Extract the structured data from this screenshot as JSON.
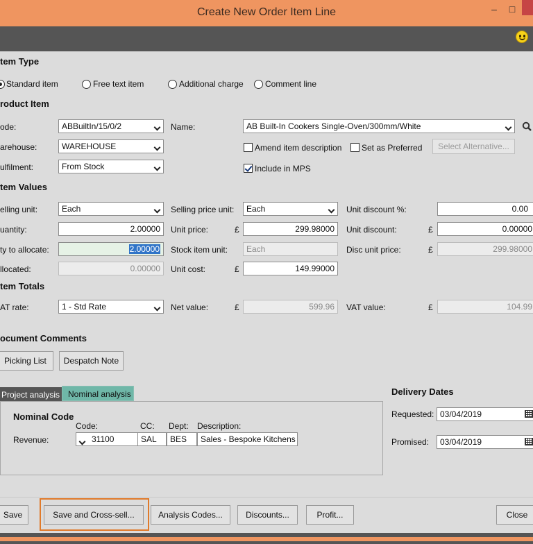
{
  "window": {
    "title": "Create New Order Item Line",
    "minimize_glyph": "–",
    "maximize_glyph": "□",
    "status_icon": "smiley-icon"
  },
  "item_type": {
    "heading": "tem Type",
    "options": [
      "Standard item",
      "Free text item",
      "Additional charge",
      "Comment line"
    ],
    "selected": "Standard item"
  },
  "product_item": {
    "heading": "roduct Item",
    "code_label": "ode:",
    "code_value": "ABBuiltIn/15/0/2",
    "name_label": "Name:",
    "name_value": "AB Built-In Cookers Single-Oven/300mm/White",
    "warehouse_label": "arehouse:",
    "warehouse_value": "WAREHOUSE",
    "fulfilment_label": "ulfilment:",
    "fulfilment_value": "From Stock",
    "amend_label": "Amend item description",
    "preferred_label": "Set as Preferred",
    "alternative_button": "Select Alternative...",
    "include_mps_label": "Include in MPS",
    "amend_checked": false,
    "preferred_checked": false,
    "include_mps_checked": true
  },
  "item_values": {
    "heading": "tem Values",
    "selling_unit_label": "elling unit:",
    "selling_unit_value": "Each",
    "selling_price_unit_label": "Selling price unit:",
    "selling_price_unit_value": "Each",
    "unit_discount_pct_label": "Unit discount %:",
    "unit_discount_pct_value": "0.00",
    "quantity_label": "uantity:",
    "quantity_value": "2.00000",
    "unit_price_label": "Unit price:",
    "unit_price_currency": "£",
    "unit_price_value": "299.98000",
    "unit_discount_label": "Unit discount:",
    "unit_discount_currency": "£",
    "unit_discount_value": "0.00000",
    "qty_allocate_label": "ty to allocate:",
    "qty_allocate_value": "2.00000",
    "stock_item_unit_label": "Stock item unit:",
    "stock_item_unit_value": "Each",
    "disc_unit_price_label": "Disc unit price:",
    "disc_unit_price_currency": "£",
    "disc_unit_price_value": "299.98000",
    "allocated_label": "llocated:",
    "allocated_value": "0.00000",
    "unit_cost_label": "Unit cost:",
    "unit_cost_currency": "£",
    "unit_cost_value": "149.99000"
  },
  "item_totals": {
    "heading": "tem Totals",
    "vat_rate_label": "AT rate:",
    "vat_rate_value": "1 - Std Rate",
    "net_value_label": "Net value:",
    "net_value_currency": "£",
    "net_value_value": "599.96",
    "vat_value_label": "VAT value:",
    "vat_value_currency": "£",
    "vat_value_value": "104.99"
  },
  "document_comments": {
    "heading": "ocument Comments",
    "picking_list_button": "Picking List",
    "despatch_note_button": "Despatch Note"
  },
  "analysis": {
    "tabs": [
      "Project analysis",
      "Nominal analysis"
    ],
    "active_tab": "Project analysis",
    "nominal_code_heading": "Nominal Code",
    "col_code": "Code:",
    "col_cc": "CC:",
    "col_dept": "Dept:",
    "col_description": "Description:",
    "row_label": "Revenue:",
    "code_value": "31100",
    "cc_value": "SAL",
    "dept_value": "BES",
    "description_value": "Sales - Bespoke Kitchens"
  },
  "delivery_dates": {
    "heading": "Delivery Dates",
    "requested_label": "Requested:",
    "requested_value": "03/04/2019",
    "promised_label": "Promised:",
    "promised_value": "03/04/2019"
  },
  "footer": {
    "save": "Save",
    "save_cross_sell": "Save and Cross-sell...",
    "analysis_codes": "Analysis Codes...",
    "discounts": "Discounts...",
    "profit": "Profit...",
    "close": "Close"
  },
  "colors": {
    "titlebar": "#ef9560",
    "toolbar": "#555555",
    "tab_nominal": "#6fb7a8",
    "highlight_ring": "#e07a2a"
  }
}
